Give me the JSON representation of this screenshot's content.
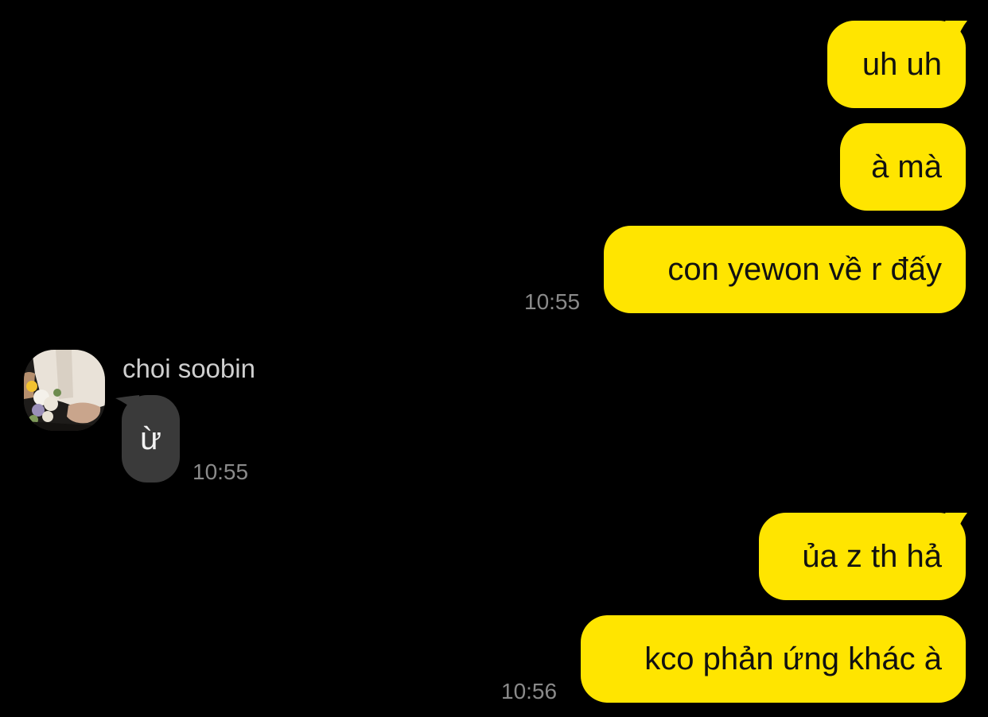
{
  "colors": {
    "background": "#000000",
    "outgoing_bubble": "#FFE500",
    "incoming_bubble": "#3A3A3A",
    "timestamp": "#8A8A8A",
    "sender_name": "#CFCFCF"
  },
  "messages": [
    {
      "direction": "outgoing",
      "text": "uh uh"
    },
    {
      "direction": "outgoing",
      "text": "à mà"
    },
    {
      "direction": "outgoing",
      "text": "con yewon về r đấy",
      "time": "10:55"
    },
    {
      "direction": "incoming",
      "sender": "choi soobin",
      "text": "ừ",
      "time": "10:55"
    },
    {
      "direction": "outgoing",
      "text": "ủa z th hả"
    },
    {
      "direction": "outgoing",
      "text": "kco phản ứng khác à",
      "time": "10:56"
    }
  ],
  "icons": {
    "avatar": "profile-photo-avatar"
  }
}
